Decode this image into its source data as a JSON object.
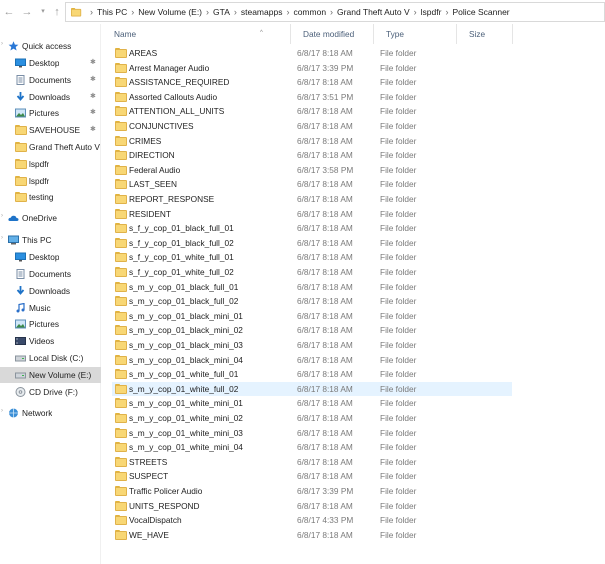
{
  "breadcrumbs": [
    "This PC",
    "New Volume (E:)",
    "GTA",
    "steamapps",
    "common",
    "Grand Theft Auto V",
    "lspdfr",
    "Police Scanner"
  ],
  "nav": {
    "quick_access": "Quick access",
    "pinned": [
      {
        "label": "Desktop",
        "icon": "desktop-icon",
        "pinned": true
      },
      {
        "label": "Documents",
        "icon": "documents-icon",
        "pinned": true
      },
      {
        "label": "Downloads",
        "icon": "downloads-icon",
        "pinned": true
      },
      {
        "label": "Pictures",
        "icon": "pictures-icon",
        "pinned": true
      },
      {
        "label": "SAVEHOUSE",
        "icon": "folder-icon",
        "pinned": true
      },
      {
        "label": "Grand Theft Auto V",
        "icon": "folder-icon",
        "pinned": false
      },
      {
        "label": "lspdfr",
        "icon": "folder-icon",
        "pinned": false
      },
      {
        "label": "lspdfr",
        "icon": "folder-icon",
        "pinned": false
      },
      {
        "label": "testing",
        "icon": "folder-icon",
        "pinned": false
      }
    ],
    "onedrive": "OneDrive",
    "this_pc": "This PC",
    "pc_items": [
      {
        "label": "Desktop",
        "icon": "desktop-icon"
      },
      {
        "label": "Documents",
        "icon": "documents-icon"
      },
      {
        "label": "Downloads",
        "icon": "downloads-icon"
      },
      {
        "label": "Music",
        "icon": "music-icon"
      },
      {
        "label": "Pictures",
        "icon": "pictures-icon"
      },
      {
        "label": "Videos",
        "icon": "videos-icon"
      },
      {
        "label": "Local Disk (C:)",
        "icon": "drive-icon"
      },
      {
        "label": "New Volume (E:)",
        "icon": "drive-icon",
        "selected": true
      },
      {
        "label": "CD Drive (F:)",
        "icon": "cd-drive-icon"
      }
    ],
    "network": "Network"
  },
  "columns": {
    "name": "Name",
    "date": "Date modified",
    "type": "Type",
    "size": "Size"
  },
  "files": [
    {
      "name": "AREAS",
      "date": "6/8/17 8:18 AM",
      "type": "File folder"
    },
    {
      "name": "Arrest Manager Audio",
      "date": "6/8/17 3:39 PM",
      "type": "File folder"
    },
    {
      "name": "ASSISTANCE_REQUIRED",
      "date": "6/8/17 8:18 AM",
      "type": "File folder"
    },
    {
      "name": "Assorted Callouts Audio",
      "date": "6/8/17 3:51 PM",
      "type": "File folder"
    },
    {
      "name": "ATTENTION_ALL_UNITS",
      "date": "6/8/17 8:18 AM",
      "type": "File folder"
    },
    {
      "name": "CONJUNCTIVES",
      "date": "6/8/17 8:18 AM",
      "type": "File folder"
    },
    {
      "name": "CRIMES",
      "date": "6/8/17 8:18 AM",
      "type": "File folder"
    },
    {
      "name": "DIRECTION",
      "date": "6/8/17 8:18 AM",
      "type": "File folder"
    },
    {
      "name": "Federal Audio",
      "date": "6/8/17 3:58 PM",
      "type": "File folder"
    },
    {
      "name": "LAST_SEEN",
      "date": "6/8/17 8:18 AM",
      "type": "File folder"
    },
    {
      "name": "REPORT_RESPONSE",
      "date": "6/8/17 8:18 AM",
      "type": "File folder"
    },
    {
      "name": "RESIDENT",
      "date": "6/8/17 8:18 AM",
      "type": "File folder"
    },
    {
      "name": "s_f_y_cop_01_black_full_01",
      "date": "6/8/17 8:18 AM",
      "type": "File folder"
    },
    {
      "name": "s_f_y_cop_01_black_full_02",
      "date": "6/8/17 8:18 AM",
      "type": "File folder"
    },
    {
      "name": "s_f_y_cop_01_white_full_01",
      "date": "6/8/17 8:18 AM",
      "type": "File folder"
    },
    {
      "name": "s_f_y_cop_01_white_full_02",
      "date": "6/8/17 8:18 AM",
      "type": "File folder"
    },
    {
      "name": "s_m_y_cop_01_black_full_01",
      "date": "6/8/17 8:18 AM",
      "type": "File folder"
    },
    {
      "name": "s_m_y_cop_01_black_full_02",
      "date": "6/8/17 8:18 AM",
      "type": "File folder"
    },
    {
      "name": "s_m_y_cop_01_black_mini_01",
      "date": "6/8/17 8:18 AM",
      "type": "File folder"
    },
    {
      "name": "s_m_y_cop_01_black_mini_02",
      "date": "6/8/17 8:18 AM",
      "type": "File folder"
    },
    {
      "name": "s_m_y_cop_01_black_mini_03",
      "date": "6/8/17 8:18 AM",
      "type": "File folder"
    },
    {
      "name": "s_m_y_cop_01_black_mini_04",
      "date": "6/8/17 8:18 AM",
      "type": "File folder"
    },
    {
      "name": "s_m_y_cop_01_white_full_01",
      "date": "6/8/17 8:18 AM",
      "type": "File folder"
    },
    {
      "name": "s_m_y_cop_01_white_full_02",
      "date": "6/8/17 8:18 AM",
      "type": "File folder",
      "hover": true
    },
    {
      "name": "s_m_y_cop_01_white_mini_01",
      "date": "6/8/17 8:18 AM",
      "type": "File folder"
    },
    {
      "name": "s_m_y_cop_01_white_mini_02",
      "date": "6/8/17 8:18 AM",
      "type": "File folder"
    },
    {
      "name": "s_m_y_cop_01_white_mini_03",
      "date": "6/8/17 8:18 AM",
      "type": "File folder"
    },
    {
      "name": "s_m_y_cop_01_white_mini_04",
      "date": "6/8/17 8:18 AM",
      "type": "File folder"
    },
    {
      "name": "STREETS",
      "date": "6/8/17 8:18 AM",
      "type": "File folder"
    },
    {
      "name": "SUSPECT",
      "date": "6/8/17 8:18 AM",
      "type": "File folder"
    },
    {
      "name": "Traffic Policer Audio",
      "date": "6/8/17 3:39 PM",
      "type": "File folder"
    },
    {
      "name": "UNITS_RESPOND",
      "date": "6/8/17 8:18 AM",
      "type": "File folder"
    },
    {
      "name": "VocalDispatch",
      "date": "6/8/17 4:33 PM",
      "type": "File folder"
    },
    {
      "name": "WE_HAVE",
      "date": "6/8/17 8:18 AM",
      "type": "File folder"
    }
  ],
  "colors": {
    "hover_row": "#e5f3ff",
    "selected_nav": "#d9d9d9",
    "header_text": "#4c607a",
    "folder": "#f8d775"
  }
}
